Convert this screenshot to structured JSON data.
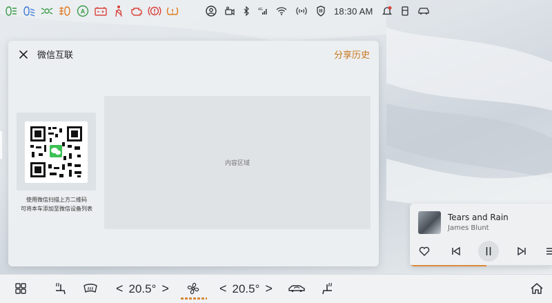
{
  "status": {
    "time": "18:30 AM",
    "indicators": [
      {
        "name": "headlight-icon",
        "color": "#3a9b4a"
      },
      {
        "name": "low-beam-icon",
        "color": "#3b78d8"
      },
      {
        "name": "side-light-icon",
        "color": "#3a9b4a"
      },
      {
        "name": "fog-light-icon",
        "color": "#e07a1f"
      },
      {
        "name": "auto-hold-icon",
        "color": "#3a9b4a"
      },
      {
        "name": "battery-icon",
        "color": "#d9413a"
      },
      {
        "name": "seatbelt-icon",
        "color": "#d9413a"
      },
      {
        "name": "engine-icon",
        "color": "#d9413a"
      },
      {
        "name": "brake-icon",
        "color": "#d9413a"
      },
      {
        "name": "tire-pressure-icon",
        "color": "#e07a1f"
      }
    ]
  },
  "panel": {
    "title": "微信互联",
    "history_label": "分享历史",
    "qr_hint_line1": "使用微信扫描上方二维码",
    "qr_hint_line2": "可将本车添加至微信设备列表",
    "content_label": "内容区域"
  },
  "media": {
    "song": "Tears and Rain",
    "artist": "James Blunt",
    "progress": 0.54
  },
  "climate": {
    "left_temp": "20.5°",
    "right_temp": "20.5°"
  },
  "colors": {
    "accent": "#c7771e",
    "progress": "#d98a3a"
  }
}
